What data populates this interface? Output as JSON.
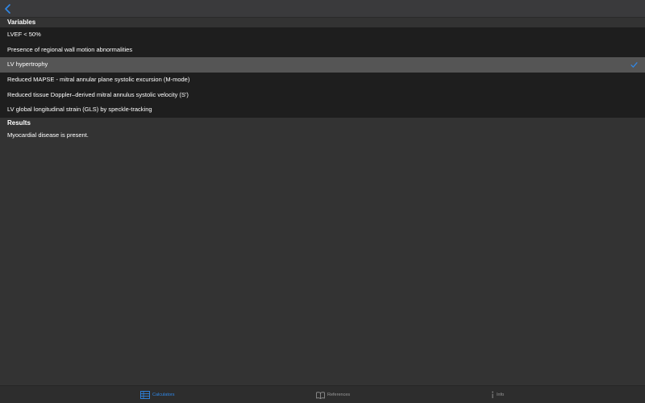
{
  "nav": {
    "back_icon": "chevron-left-icon"
  },
  "sections": {
    "variables_title": "Variables",
    "results_title": "Results"
  },
  "variables": [
    {
      "label": "LVEF < 50%",
      "selected": false
    },
    {
      "label": "Presence of regional wall motion abnormalities",
      "selected": false
    },
    {
      "label": "LV hypertrophy",
      "selected": true
    },
    {
      "label": "Reduced MAPSE - mitral annular plane systolic excursion (M-mode)",
      "selected": false
    },
    {
      "label": "Reduced tissue Doppler–derived mitral annulus systolic velocity (S')",
      "selected": false
    },
    {
      "label": "LV global longitudinal strain (GLS) by speckle-tracking",
      "selected": false
    }
  ],
  "results": {
    "text": "Myocardial disease is present."
  },
  "tabs": [
    {
      "label": "Calculators",
      "icon": "calculator-table-icon",
      "active": true
    },
    {
      "label": "References",
      "icon": "book-icon",
      "active": false
    },
    {
      "label": "Info",
      "icon": "info-icon",
      "active": false
    }
  ],
  "colors": {
    "accent": "#2f88e8",
    "background": "#333333",
    "row_background": "#1e1e1e",
    "row_selected": "#555555",
    "tab_inactive": "#9a9a9a"
  }
}
